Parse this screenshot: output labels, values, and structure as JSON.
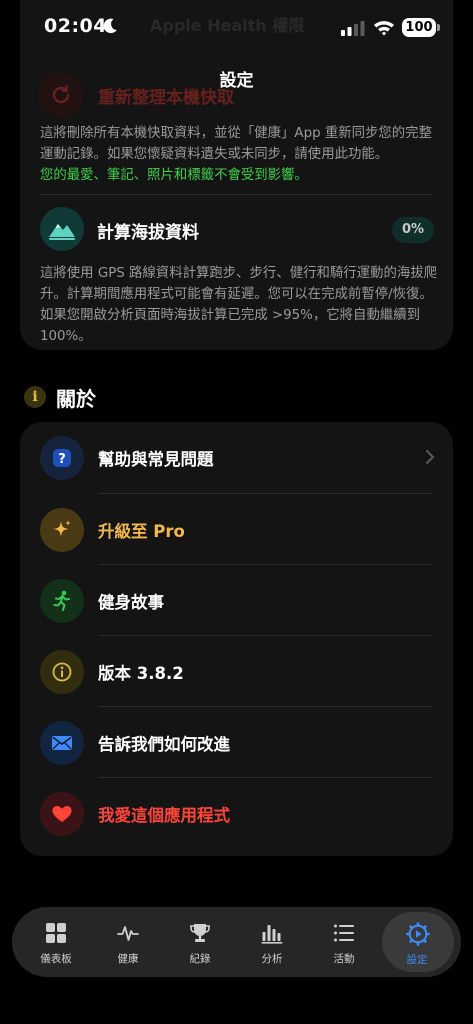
{
  "status_bar": {
    "time": "02:04",
    "battery": "100",
    "icons": [
      "moon-icon",
      "signal-icon",
      "wifi-icon",
      "battery-icon"
    ]
  },
  "header": {
    "ghost_title": "Apple Health 權限",
    "title": "設定"
  },
  "data_section": {
    "reset_label": "重新整理本機快取",
    "reset_desc": "這將刪除所有本機快取資料，並從「健康」App 重新同步您的完整運動記錄。如果您懷疑資料遺失或未同步，請使用此功能。",
    "reset_note": "您的最愛、筆記、照片和標籤不會受到影響。",
    "altitude_label": "計算海拔資料",
    "altitude_progress": "0%",
    "altitude_desc": "這將使用 GPS 路線資料計算跑步、步行、健行和騎行運動的海拔爬升。計算期間應用程式可能會有延遲。您可以在完成前暫停/恢復。如果您開啟分析頁面時海拔計算已完成 >95%，它將自動繼續到100%。"
  },
  "about": {
    "section_title": "關於",
    "items": [
      {
        "label": "幫助與常見問題",
        "icon": "question-icon",
        "color": "#ffffff"
      },
      {
        "label": "升級至 Pro",
        "icon": "sparkle-icon",
        "color": "#f2b84b"
      },
      {
        "label": "健身故事",
        "icon": "runner-icon",
        "color": "#ffffff"
      },
      {
        "label": "版本 3.8.2",
        "icon": "info-icon",
        "color": "#ffffff"
      },
      {
        "label": "告訴我們如何改進",
        "icon": "mail-icon",
        "color": "#ffffff"
      },
      {
        "label": "我愛這個應用程式",
        "icon": "heart-icon",
        "color": "#ff453a"
      }
    ]
  },
  "tabbar": {
    "tabs": [
      {
        "label": "儀表板",
        "icon": "grid-icon"
      },
      {
        "label": "健康",
        "icon": "heartbeat-icon"
      },
      {
        "label": "紀錄",
        "icon": "trophy-icon"
      },
      {
        "label": "分析",
        "icon": "bar-chart-icon"
      },
      {
        "label": "活動",
        "icon": "list-icon"
      },
      {
        "label": "設定",
        "icon": "gear-icon"
      }
    ],
    "active": "設定"
  },
  "colors": {
    "accent": "#3d8bff",
    "green_note": "#3fcf4a",
    "destructive": "#ff3b30",
    "pro": "#f2b84b"
  }
}
